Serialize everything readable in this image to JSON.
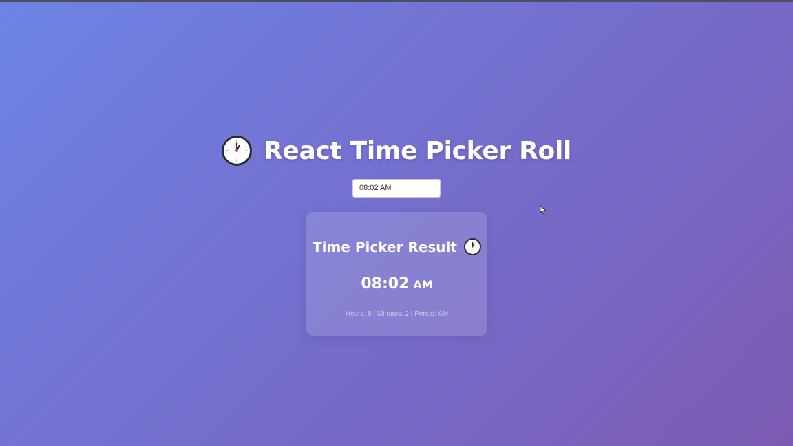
{
  "app": {
    "title": "React Time Picker Roll",
    "title_icon": "clock-icon"
  },
  "time_input": {
    "value": "08:02 AM"
  },
  "result_card": {
    "title": "Time Picker Result",
    "title_icon": "clock-icon",
    "time": "08:02",
    "period": "AM",
    "details_hours_label": "Hours:",
    "details_hours": "8",
    "details_minutes_label": "Minutes:",
    "details_minutes": "2",
    "details_period_label": "Period:",
    "details_period": "AM",
    "details_separator": "|"
  },
  "colors": {
    "background_start": "#6d84e4",
    "background_end": "#7c5bb4",
    "text": "#ffffff"
  }
}
